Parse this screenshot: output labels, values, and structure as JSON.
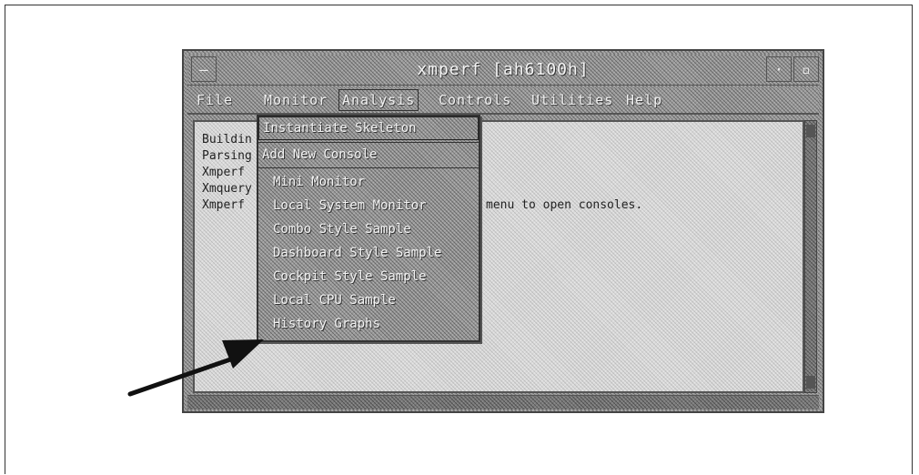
{
  "window": {
    "title": "xmperf [ah6100h]"
  },
  "menubar": {
    "items": [
      {
        "label": "File"
      },
      {
        "label": "Monitor"
      },
      {
        "label": "Analysis"
      },
      {
        "label": "Controls"
      },
      {
        "label": "Utilities"
      },
      {
        "label": "Help"
      }
    ]
  },
  "log": {
    "lines": [
      {
        "prefix": "Buildin",
        "suffix": ""
      },
      {
        "prefix": "Parsing",
        "suffix": ""
      },
      {
        "prefix": "Xmperf ",
        "suffix": ""
      },
      {
        "prefix": "Xmquery",
        "suffix": ""
      },
      {
        "prefix": "Xmperf ",
        "suffix": "menu to open consoles."
      }
    ]
  },
  "dropdown": {
    "items": [
      {
        "label": "Instantiate Skeleton"
      },
      {
        "label": "Add New Console"
      },
      {
        "label": "Mini Monitor"
      },
      {
        "label": "Local System Monitor"
      },
      {
        "label": "Combo Style Sample"
      },
      {
        "label": "Dashboard Style Sample"
      },
      {
        "label": "Cockpit Style Sample"
      },
      {
        "label": "Local CPU Sample"
      },
      {
        "label": "History Graphs"
      }
    ]
  }
}
